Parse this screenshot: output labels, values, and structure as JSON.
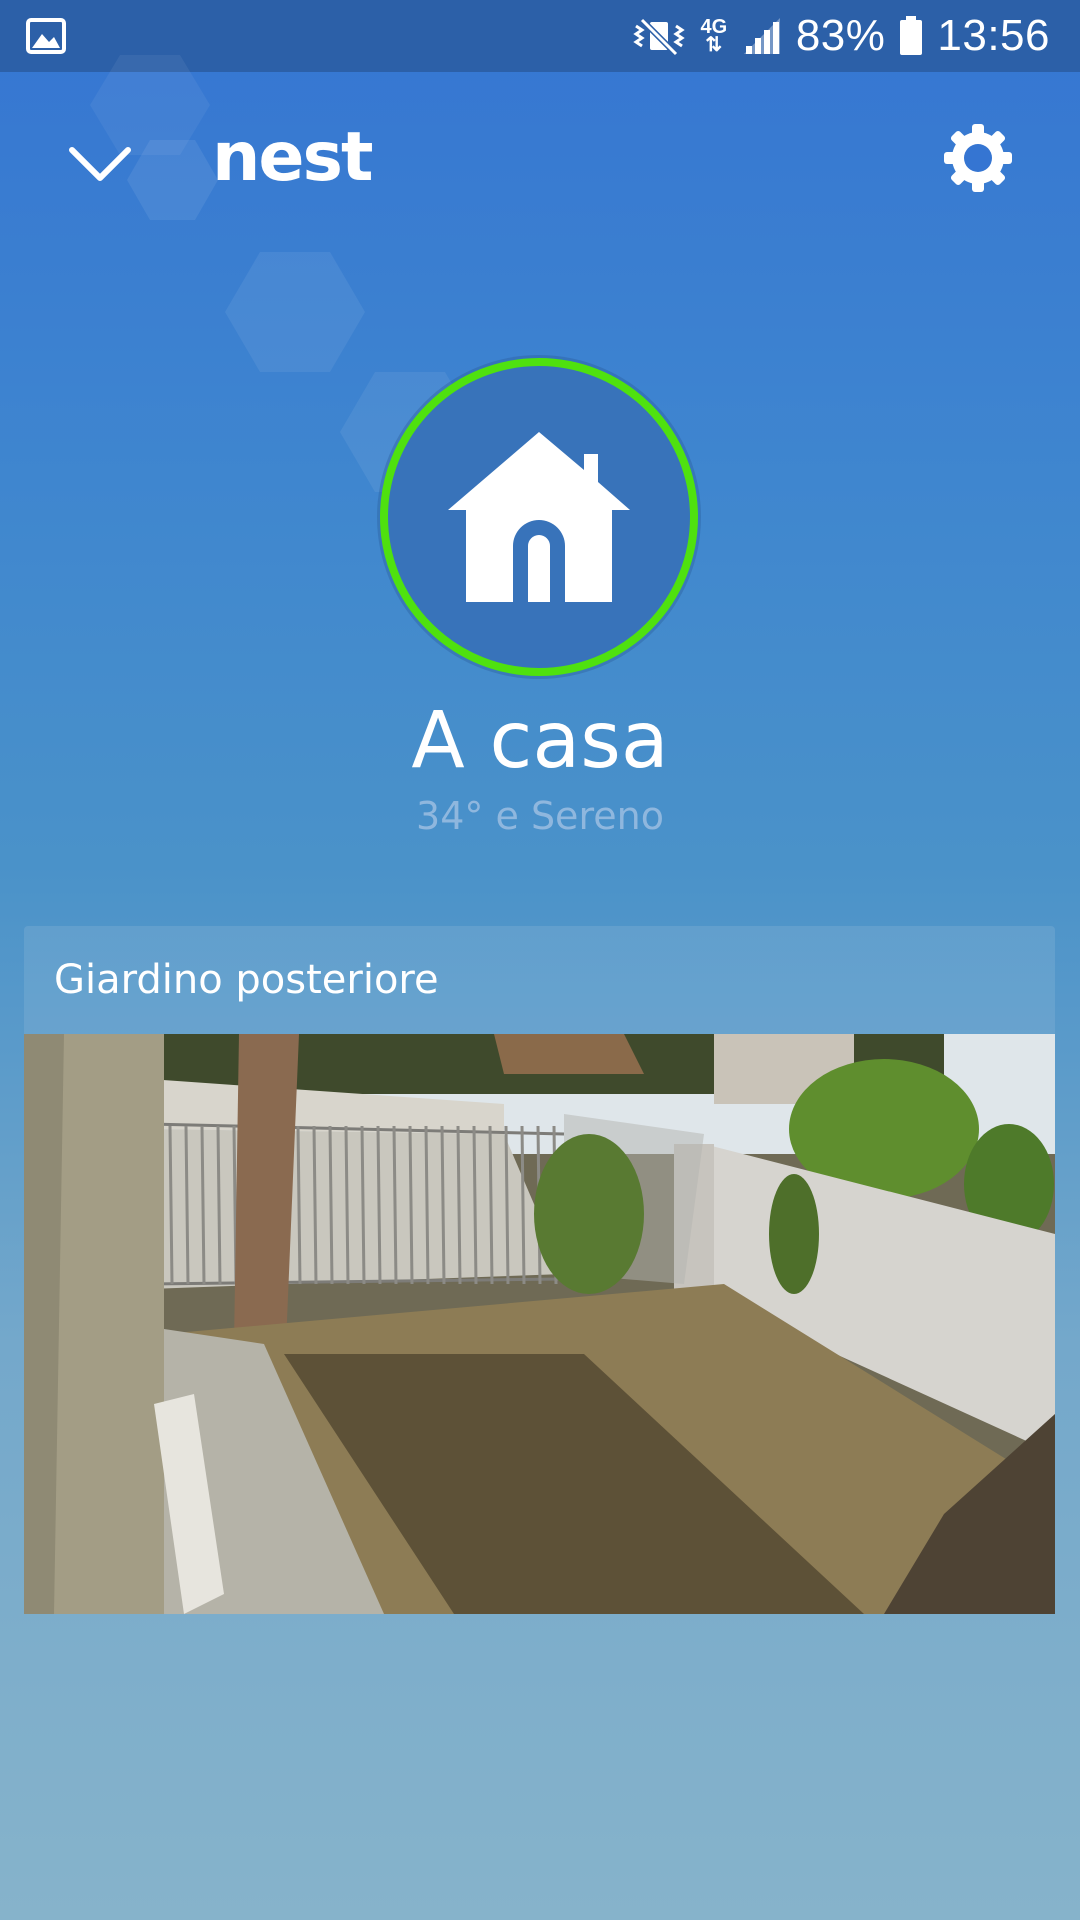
{
  "status_bar": {
    "battery_percent": "83%",
    "time": "13:56",
    "network": "4G",
    "icons": [
      "gallery-icon",
      "vibrate-mute-icon",
      "data-4g-icon",
      "signal-icon",
      "battery-icon"
    ]
  },
  "app_bar": {
    "logo_text": "nest",
    "icons": [
      "chevron-down-icon",
      "gear-icon"
    ]
  },
  "home": {
    "status": "A casa",
    "weather": "34° e Sereno",
    "icon": "home-icon",
    "ring_color": "#4fe10f"
  },
  "camera": {
    "name": "Giardino posteriore"
  }
}
